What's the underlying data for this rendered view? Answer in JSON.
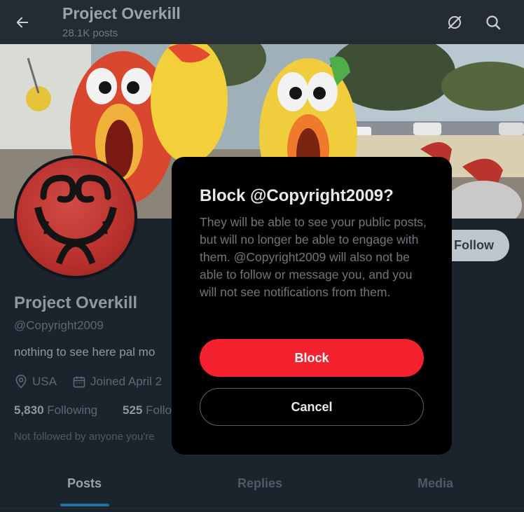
{
  "header": {
    "title": "Project Overkill",
    "posts_count": "28.1K posts",
    "back_icon": "arrow-left-icon",
    "grok_icon": "grok-icon",
    "search_icon": "search-icon"
  },
  "profile": {
    "name": "Project Overkill",
    "handle": "@Copyright2009",
    "bio": "nothing to see here pal mo",
    "location": "USA",
    "joined": "Joined April 2",
    "following_count": "5,830",
    "following_label": "Following",
    "followers_count": "525",
    "followers_label": "Follo",
    "notice": "Not followed by anyone you're",
    "follow_button": "Follow"
  },
  "tabs": [
    {
      "label": "Posts"
    },
    {
      "label": "Replies"
    },
    {
      "label": "Media"
    }
  ],
  "modal": {
    "title": "Block @Copyright2009?",
    "body": "They will be able to see your public posts, but will no longer be able to engage with them. @Copyright2009 will also not be able to follow or message you, and you will not see notifications from them.",
    "block_button": "Block",
    "cancel_button": "Cancel"
  },
  "colors": {
    "block_red": "#f4212e",
    "modal_bg": "#000000",
    "accent_blue": "#1d74aa"
  }
}
